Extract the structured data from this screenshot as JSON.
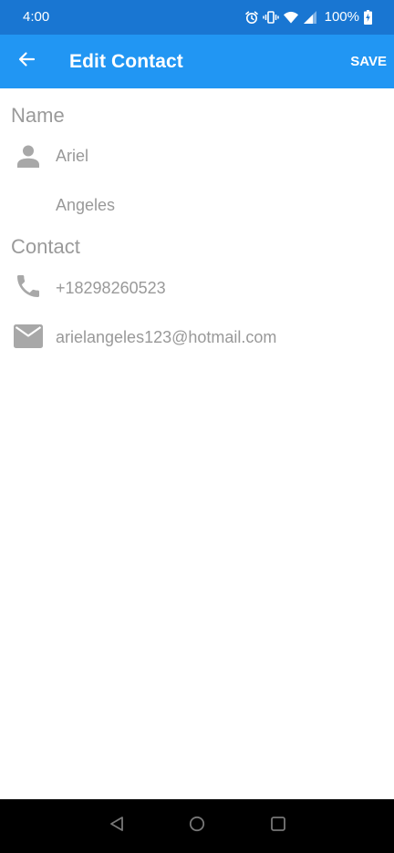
{
  "status_bar": {
    "time": "4:00",
    "battery": "100%",
    "icons": [
      "alarm-icon",
      "vibrate-icon",
      "wifi-icon",
      "cellular-signal-icon",
      "battery-charging-icon"
    ]
  },
  "app_bar": {
    "back_icon": "arrow-back-icon",
    "title": "Edit Contact",
    "save_label": "SAVE"
  },
  "form": {
    "name_section": {
      "header": "Name",
      "icon": "person-icon",
      "first_name": "Ariel",
      "last_name": "Angeles"
    },
    "contact_section": {
      "header": "Contact",
      "phone_icon": "phone-icon",
      "phone": "+18298260523",
      "email_icon": "email-icon",
      "email": "arielangeles123@hotmail.com"
    }
  },
  "nav_bar": {
    "icons": [
      "nav-back-icon",
      "nav-home-icon",
      "nav-recents-icon"
    ]
  },
  "colors": {
    "status_bar": "#1976d2",
    "app_bar": "#2196f3",
    "text_muted": "#999999",
    "icon_gray": "#a8a8a8",
    "nav_bar": "#000000"
  }
}
